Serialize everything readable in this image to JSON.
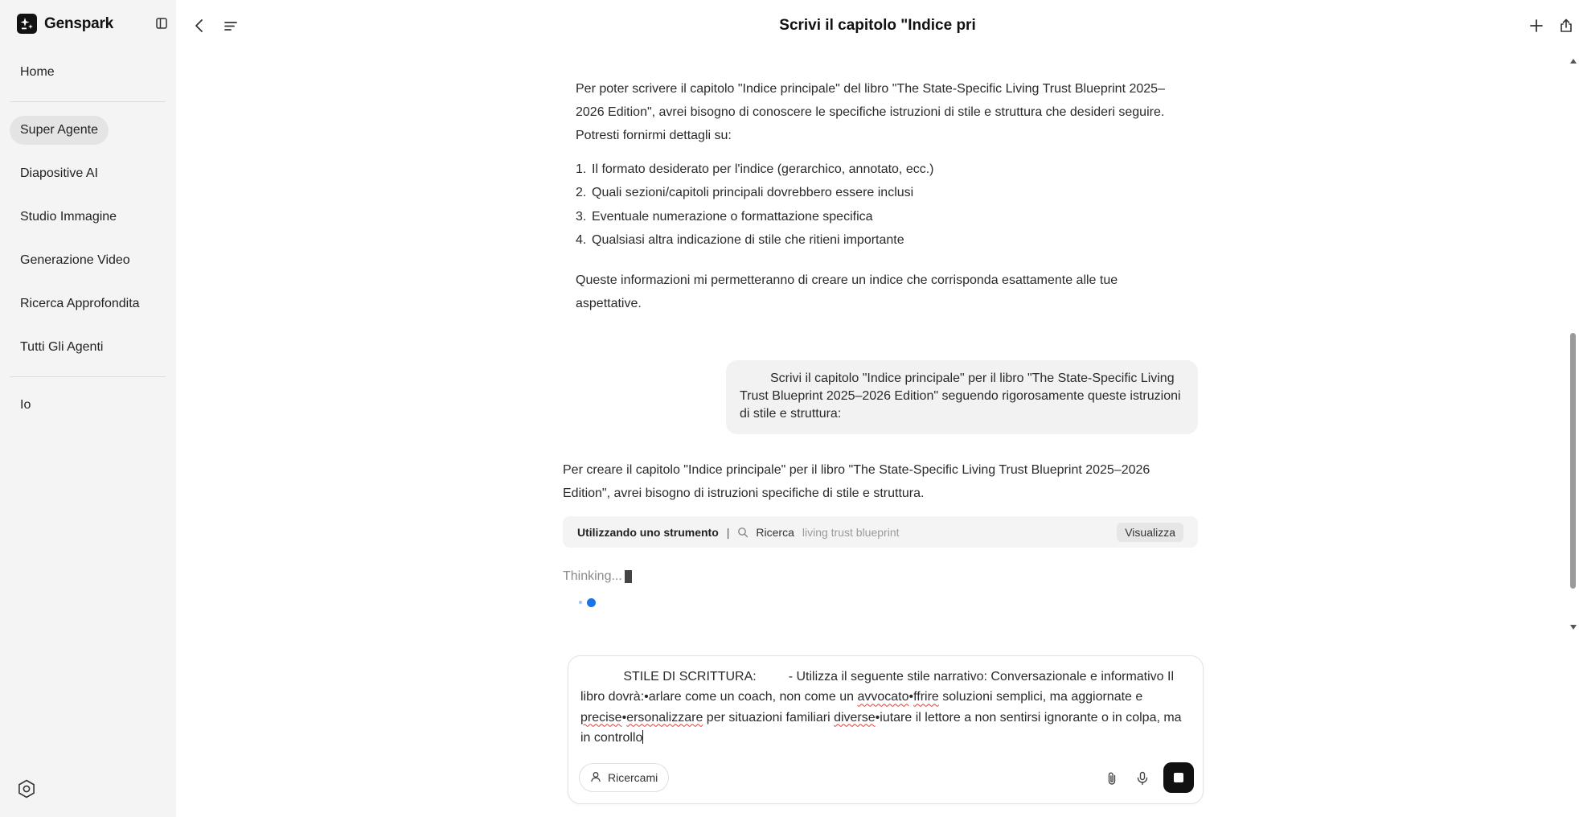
{
  "app": {
    "brand": "Genspark"
  },
  "sidebar": {
    "items": [
      {
        "label": "Home"
      },
      {
        "label": "Super Agente",
        "active": true
      },
      {
        "label": "Diapositive AI"
      },
      {
        "label": "Studio Immagine"
      },
      {
        "label": "Generazione Video"
      },
      {
        "label": "Ricerca Approfondita"
      },
      {
        "label": "Tutti Gli Agenti"
      },
      {
        "label": "Io"
      }
    ]
  },
  "header": {
    "title": "Scrivi il capitolo \"Indice pri"
  },
  "conversation": {
    "assistant_1": {
      "intro": "Per poter scrivere il capitolo \"Indice principale\" del libro \"The State-Specific Living Trust Blueprint 2025–2026 Edition\", avrei bisogno di conoscere le specifiche istruzioni di stile e struttura che desideri seguire. Potresti fornirmi dettagli su:",
      "list": [
        {
          "num": "1.",
          "text": "Il formato desiderato per l'indice (gerarchico, annotato, ecc.)"
        },
        {
          "num": "2.",
          "text": "Quali sezioni/capitoli principali dovrebbero essere inclusi"
        },
        {
          "num": "3.",
          "text": "Eventuale numerazione o formattazione specifica"
        },
        {
          "num": "4.",
          "text": "Qualsiasi altra indicazione di stile che ritieni importante"
        }
      ],
      "outro": "Queste informazioni mi permetteranno di creare un indice che corrisponda esattamente alle tue aspettative."
    },
    "user_1": {
      "text": "Scrivi il capitolo \"Indice principale\" per il libro \"The State-Specific Living Trust Blueprint 2025–2026 Edition\" seguendo rigorosamente queste istruzioni di stile e struttura:"
    },
    "assistant_2": {
      "text": "Per creare il capitolo \"Indice principale\" per il libro \"The State-Specific Living Trust Blueprint 2025–2026 Edition\", avrei bisogno di istruzioni specifiche di stile e struttura."
    },
    "tool": {
      "label": "Utilizzando uno strumento",
      "separator": "|",
      "name": "Ricerca",
      "query": "living trust blueprint",
      "view_label": "Visualizza"
    },
    "thinking": "Thinking..."
  },
  "composer": {
    "segments": [
      {
        "t": "            STILE DI SCRITTURA:         - Utilizza il seguente stile narrativo: Conversazionale e informativo Il libro dovrà:•arlare come un coach, non come un "
      },
      {
        "t": "avvocato",
        "err": true
      },
      {
        "t": "•"
      },
      {
        "t": "ffrire",
        "err": true
      },
      {
        "t": " soluzioni semplici, ma aggiornate e "
      },
      {
        "t": "precise",
        "err": true
      },
      {
        "t": "•"
      },
      {
        "t": "ersonalizzare",
        "err": true
      },
      {
        "t": " per situazioni familiari "
      },
      {
        "t": "diverse",
        "err": true
      },
      {
        "t": "•iutare il lettore a non sentirsi ignorante o in colpa, ma in controllo"
      }
    ],
    "mode_label": "Ricercami"
  }
}
